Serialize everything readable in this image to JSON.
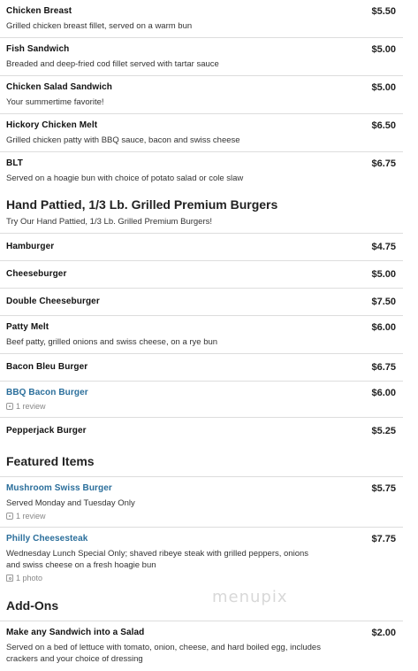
{
  "sections": {
    "top_items": [
      {
        "name": "Chicken Breast",
        "price": "$5.50",
        "desc": "Grilled chicken breast fillet, served on a warm bun"
      },
      {
        "name": "Fish Sandwich",
        "price": "$5.00",
        "desc": "Breaded and deep-fried cod fillet served with tartar sauce"
      },
      {
        "name": "Chicken Salad Sandwich",
        "price": "$5.00",
        "desc": "Your summertime favorite!"
      },
      {
        "name": "Hickory Chicken Melt",
        "price": "$6.50",
        "desc": "Grilled chicken patty with BBQ sauce, bacon and swiss cheese"
      },
      {
        "name": "BLT",
        "price": "$6.75",
        "desc": "Served on a hoagie bun with choice of potato salad or cole slaw"
      }
    ],
    "burgers": {
      "title": "Hand Pattied, 1/3 Lb. Grilled Premium Burgers",
      "desc": "Try Our Hand Pattied, 1/3 Lb. Grilled Premium Burgers!",
      "items": [
        {
          "name": "Hamburger",
          "price": "$4.75"
        },
        {
          "name": "Cheeseburger",
          "price": "$5.00"
        },
        {
          "name": "Double Cheeseburger",
          "price": "$7.50"
        },
        {
          "name": "Patty Melt",
          "price": "$6.00",
          "desc": "Beef patty, grilled onions and swiss cheese, on a rye bun"
        },
        {
          "name": "Bacon Bleu Burger",
          "price": "$6.75"
        },
        {
          "name": "BBQ Bacon Burger",
          "price": "$6.00",
          "meta": "1 review"
        },
        {
          "name": "Pepperjack Burger",
          "price": "$5.25"
        }
      ]
    },
    "featured": {
      "title": "Featured Items",
      "items": [
        {
          "name": "Mushroom Swiss Burger",
          "price": "$5.75",
          "desc": "Served Monday and Tuesday Only",
          "meta": "1 review"
        },
        {
          "name": "Philly Cheesesteak",
          "price": "$7.75",
          "desc": "Wednesday Lunch Special Only; shaved ribeye steak with grilled peppers, onions and swiss cheese on a fresh hoagie bun",
          "meta": "1 photo"
        }
      ]
    },
    "addons": {
      "title": "Add-Ons",
      "items": [
        {
          "name": "Make any Sandwich into a Salad",
          "price": "$2.00",
          "desc": "Served on a bed of lettuce with tomato, onion, cheese, and hard boiled egg, includes crackers and your choice of dressing"
        }
      ]
    }
  },
  "watermark": "menupix",
  "colors": {
    "link": "#2a6e9b",
    "divider": "#dddddd",
    "meta": "#888888"
  }
}
